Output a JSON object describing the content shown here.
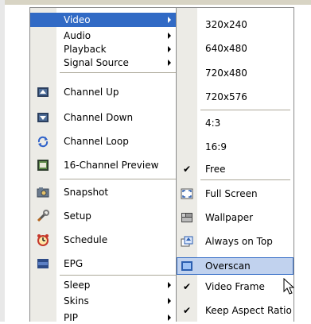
{
  "main_menu": {
    "items": [
      {
        "label": "Video",
        "submenu": true,
        "highlighted": true
      },
      {
        "label": "Audio",
        "submenu": true
      },
      {
        "label": "Playback",
        "submenu": true
      },
      {
        "label": "Signal Source",
        "submenu": true
      },
      {
        "label": "Channel Up",
        "icon": "channel-up-icon"
      },
      {
        "label": "Channel Down",
        "icon": "channel-down-icon"
      },
      {
        "label": "Channel Loop",
        "icon": "channel-loop-icon"
      },
      {
        "label": "16-Channel Preview",
        "icon": "sixteen-channel-icon"
      },
      {
        "label": "Snapshot",
        "icon": "camera-icon"
      },
      {
        "label": "Setup",
        "icon": "tools-icon"
      },
      {
        "label": "Schedule",
        "icon": "alarm-clock-icon"
      },
      {
        "label": "EPG",
        "icon": "epg-icon"
      },
      {
        "label": "Sleep",
        "submenu": true
      },
      {
        "label": "Skins",
        "submenu": true
      },
      {
        "label": "PIP",
        "submenu": true
      }
    ]
  },
  "video_submenu": {
    "items": [
      {
        "label": "320x240"
      },
      {
        "label": "640x480"
      },
      {
        "label": "720x480"
      },
      {
        "label": "720x576"
      },
      {
        "label": "4:3"
      },
      {
        "label": "16:9"
      },
      {
        "label": "Free",
        "checked": true
      },
      {
        "label": "Full Screen",
        "icon": "fullscreen-icon"
      },
      {
        "label": "Wallpaper",
        "icon": "wallpaper-icon"
      },
      {
        "label": "Always on Top",
        "icon": "always-on-top-icon"
      },
      {
        "label": "Overscan",
        "icon": "overscan-icon",
        "highlighted": true
      },
      {
        "label": "Video Frame",
        "checked": true
      },
      {
        "label": "Keep Aspect Ratio",
        "checked": true
      }
    ]
  },
  "check_glyph": "✔",
  "colors": {
    "highlight": "#316ac5",
    "hover": "#c1d2ee",
    "gutter": "#ecebe6"
  }
}
